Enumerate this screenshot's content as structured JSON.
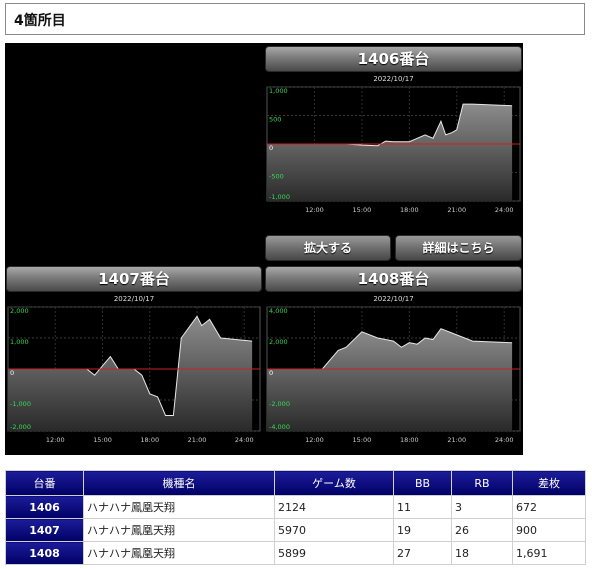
{
  "section": {
    "title": "4箇所目"
  },
  "actions": {
    "zoom": "拡大する",
    "details": "詳細はこちら"
  },
  "charts": [
    {
      "id": "c1406",
      "machine": "1406番台",
      "date": "2022/10/17",
      "yticks": [
        "1,000",
        "500",
        "0",
        "-500",
        "-1,000"
      ],
      "xticks": [
        "12:00",
        "15:00",
        "18:00",
        "21:00",
        "24:00"
      ]
    },
    {
      "id": "c1407",
      "machine": "1407番台",
      "date": "2022/10/17",
      "yticks": [
        "2,000",
        "1,000",
        "0",
        "-1,000",
        "-2,000"
      ],
      "xticks": [
        "12:00",
        "15:00",
        "18:00",
        "21:00",
        "24:00"
      ]
    },
    {
      "id": "c1408",
      "machine": "1408番台",
      "date": "2022/10/17",
      "yticks": [
        "4,000",
        "2,000",
        "0",
        "-2,000",
        "-4,000"
      ],
      "xticks": [
        "12:00",
        "15:00",
        "18:00",
        "21:00",
        "24:00"
      ]
    }
  ],
  "chart_data": [
    {
      "type": "area",
      "title": "1406番台",
      "subtitle": "2022/10/17",
      "xlabel": "",
      "ylabel": "",
      "ylim": [
        -1000,
        1000
      ],
      "xlim": [
        9,
        25
      ],
      "x": [
        9,
        14,
        15,
        16,
        16.5,
        17,
        17.5,
        18,
        19,
        19.5,
        20,
        20.3,
        20.7,
        21,
        21.4,
        22,
        24.5
      ],
      "values": [
        0,
        0,
        -20,
        -30,
        50,
        40,
        40,
        40,
        160,
        100,
        400,
        160,
        200,
        250,
        700,
        700,
        672
      ]
    },
    {
      "type": "area",
      "title": "1407番台",
      "subtitle": "2022/10/17",
      "xlabel": "",
      "ylabel": "",
      "ylim": [
        -2000,
        2000
      ],
      "xlim": [
        9,
        25
      ],
      "x": [
        9,
        14,
        14.5,
        15.5,
        16,
        17,
        17.5,
        18,
        18.5,
        19,
        19.5,
        20,
        21,
        21.3,
        21.8,
        22.5,
        24.5
      ],
      "values": [
        0,
        0,
        -200,
        400,
        0,
        0,
        -200,
        -800,
        -900,
        -1500,
        -1500,
        1000,
        1700,
        1400,
        1600,
        1000,
        900
      ]
    },
    {
      "type": "area",
      "title": "1408番台",
      "subtitle": "2022/10/17",
      "xlabel": "",
      "ylabel": "",
      "ylim": [
        -4000,
        4000
      ],
      "xlim": [
        9,
        25
      ],
      "x": [
        9,
        12.5,
        13.5,
        14,
        15,
        16,
        17,
        17.5,
        18,
        18.5,
        19,
        19.5,
        20,
        21,
        21.5,
        22,
        24.5
      ],
      "values": [
        0,
        0,
        1200,
        1400,
        2400,
        2000,
        1800,
        1400,
        1700,
        1600,
        2000,
        1900,
        2600,
        2200,
        2000,
        1800,
        1691
      ]
    }
  ],
  "table": {
    "headers": [
      "台番",
      "機種名",
      "ゲーム数",
      "BB",
      "RB",
      "差枚"
    ],
    "rows": [
      [
        "1406",
        "ハナハナ鳳凰天翔",
        "2124",
        "11",
        "3",
        "672"
      ],
      [
        "1407",
        "ハナハナ鳳凰天翔",
        "5970",
        "19",
        "26",
        "900"
      ],
      [
        "1408",
        "ハナハナ鳳凰天翔",
        "5899",
        "27",
        "18",
        "1,691"
      ]
    ]
  }
}
